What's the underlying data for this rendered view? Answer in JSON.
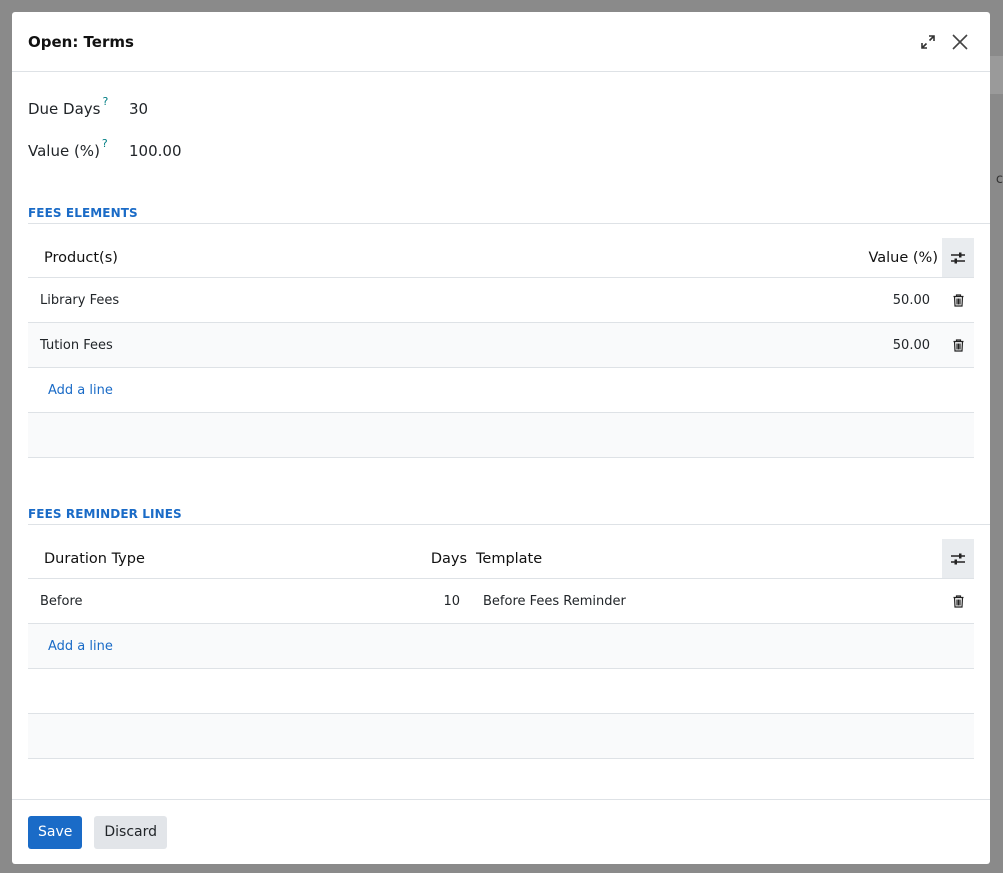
{
  "dialog": {
    "title": "Open: Terms"
  },
  "fields": {
    "due_days": {
      "label": "Due Days",
      "help": "?",
      "value": "30"
    },
    "value_pct": {
      "label": "Value (%)",
      "help": "?",
      "value": "100.00"
    }
  },
  "fees_elements": {
    "title": "FEES ELEMENTS",
    "columns": {
      "product": "Product(s)",
      "value": "Value (%)"
    },
    "rows": [
      {
        "product": "Library Fees",
        "value": "50.00"
      },
      {
        "product": "Tution Fees",
        "value": "50.00"
      }
    ],
    "add_line": "Add a line"
  },
  "reminder_lines": {
    "title": "FEES REMINDER LINES",
    "columns": {
      "duration_type": "Duration Type",
      "days": "Days",
      "template": "Template"
    },
    "rows": [
      {
        "duration_type": "Before",
        "days": "10",
        "template": "Before Fees Reminder"
      }
    ],
    "add_line": "Add a line"
  },
  "footer": {
    "save": "Save",
    "discard": "Discard"
  },
  "background": {
    "partial_text": "c"
  },
  "colors": {
    "primary": "#1a6bc7",
    "help": "#017e84"
  },
  "icons": [
    "expand-icon",
    "close-icon",
    "settings-sliders-icon",
    "trash-icon"
  ]
}
